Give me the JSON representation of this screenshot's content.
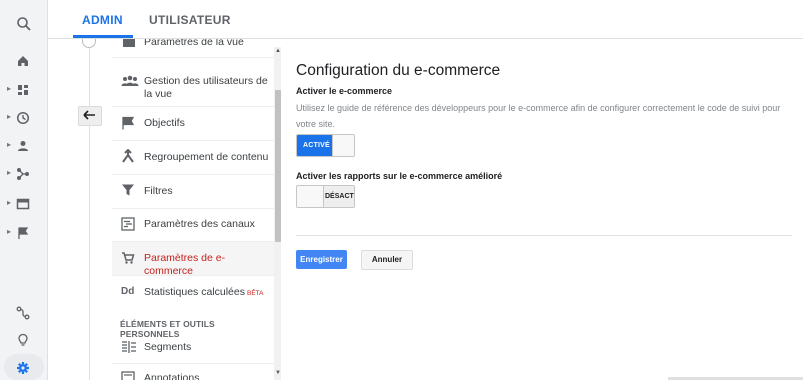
{
  "tabs": [
    {
      "label": "ADMIN",
      "active": true
    },
    {
      "label": "UTILISATEUR",
      "active": false
    }
  ],
  "rail": {
    "icons": [
      "search-icon",
      "home-icon",
      "dashboard-icon",
      "clock-icon",
      "person-icon",
      "acquisition-icon",
      "behavior-icon",
      "flag-icon",
      "attribution-icon",
      "lightbulb-icon",
      "gear-icon"
    ]
  },
  "nav": {
    "items": [
      {
        "label": "Paramètres de la vue",
        "icon": "view-settings-icon"
      },
      {
        "label": "Gestion des utilisateurs de la vue",
        "icon": "users-icon"
      },
      {
        "label": "Objectifs",
        "icon": "flag-icon"
      },
      {
        "label": "Regroupement de contenu",
        "icon": "content-grouping-icon"
      },
      {
        "label": "Filtres",
        "icon": "filter-icon"
      },
      {
        "label": "Paramètres des canaux",
        "icon": "channel-settings-icon"
      },
      {
        "label": "Paramètres de e-commerce",
        "icon": "cart-icon",
        "active": true
      },
      {
        "label": "Statistiques calculées",
        "badge": "BÊTA",
        "icon": "dd-icon"
      },
      {
        "label": "Segments",
        "icon": "segments-icon"
      },
      {
        "label": "Annotations",
        "icon": "annotations-icon"
      }
    ],
    "section_header": "ÉLÉMENTS ET OUTILS PERSONNELS"
  },
  "content": {
    "title": "Configuration du e-commerce",
    "ecommerce_label": "Activer le e-commerce",
    "help_text": "Utilisez le guide de référence des développeurs pour le e-commerce afin de configurer correctement le code de suivi pour votre site.",
    "ecommerce_toggle": {
      "state_label": "ACTIVÉ",
      "on": true
    },
    "enhanced_label": "Activer les rapports sur le e-commerce amélioré",
    "enhanced_toggle": {
      "state_label": "DÉSACTIVÉ",
      "on": false
    },
    "save_label": "Enregistrer",
    "cancel_label": "Annuler"
  },
  "colors": {
    "accent": "#1a73e8",
    "active_nav": "#c5221f",
    "save_button": "#4285f4"
  }
}
